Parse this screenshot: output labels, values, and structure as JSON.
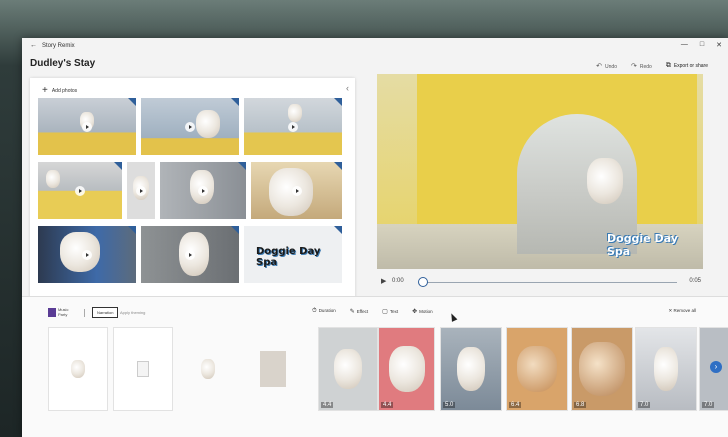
{
  "app": {
    "title": "Story Remix",
    "project_title": "Dudley's Stay"
  },
  "window_controls": [
    "—",
    "□",
    "✕"
  ],
  "toolbar": {
    "undo_label": "Undo",
    "redo_label": "Redo",
    "export_label": "Export or share"
  },
  "library": {
    "add_photos_label": "Add photos",
    "collapse_glyph": "‹"
  },
  "preview": {
    "watermark": "Doggie Day Spa",
    "current_time": "0:00",
    "end_time": "0:05"
  },
  "storyboard": {
    "music_label_top": "Music",
    "music_label_bottom": "Party",
    "narration_label": "Narration",
    "apply_label": "Apply theming",
    "actions": [
      {
        "icon": "⏱",
        "label": "Duration",
        "name": "duration"
      },
      {
        "icon": "✎",
        "label": "Effect",
        "name": "effect"
      },
      {
        "icon": "▢",
        "label": "Text",
        "name": "text"
      },
      {
        "icon": "✥",
        "label": "Motion",
        "name": "motion"
      }
    ],
    "remove_label": "Remove all",
    "cards": [
      {
        "duration": ""
      },
      {
        "duration": ""
      },
      {
        "duration": ""
      },
      {
        "duration": ""
      },
      {
        "duration": "4.4"
      },
      {
        "duration": "4.4"
      },
      {
        "duration": "5.0"
      },
      {
        "duration": "6.4"
      },
      {
        "duration": "6.8"
      },
      {
        "duration": "7.0"
      },
      {
        "duration": "7.0"
      }
    ]
  },
  "colors": {
    "accent": "#2f6fc4",
    "music_purple": "#5a3c95",
    "arch_yellow": "#e9cf4a"
  }
}
